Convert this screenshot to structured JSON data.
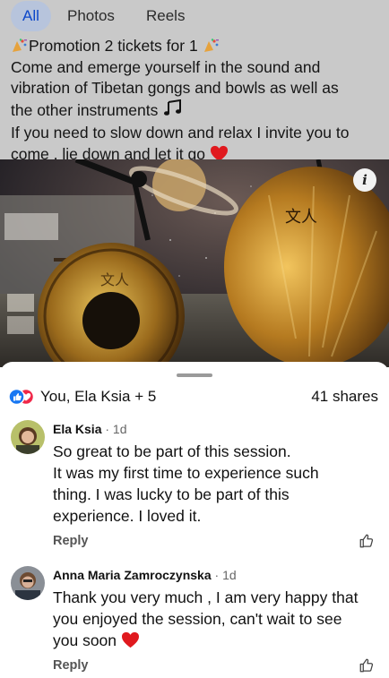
{
  "tabs": [
    {
      "label": "All"
    },
    {
      "label": "Photos"
    },
    {
      "label": "Reels"
    }
  ],
  "post": {
    "line1": "Promotion 2 tickets for 1",
    "line2": "Come and emerge yourself in the sound and",
    "line3": "vibration of Tibetan gongs and bowls as well as",
    "line4": "the other instruments",
    "line5": "If you need to slow down and relax I invite you to",
    "line6": "come , lie down and let it go"
  },
  "reactions": {
    "names": "You, Ela Ksia + 5",
    "shares": "41 shares"
  },
  "comments": [
    {
      "name": "Ela Ksia",
      "time": "· 1d",
      "lines": [
        "So great to be part of this session.",
        "It was my first time to experience such",
        "thing. I was lucky to be part of this",
        "experience. I loved it."
      ],
      "reply": "Reply"
    },
    {
      "name": "Anna Maria Zamroczynska",
      "time": "· 1d",
      "lines": [
        "Thank you very much , I am very happy that",
        "you enjoyed the session, can't wait to see",
        "you soon"
      ],
      "reply": "Reply"
    }
  ],
  "icons": {
    "info": "info-icon",
    "like_reaction": "like-reaction-icon",
    "love_reaction": "love-reaction-icon",
    "thumbs_up": "thumbs-up-icon",
    "heart": "heart-emoji-icon",
    "party": "party-popper-emoji-icon",
    "notes": "music-notes-emoji-icon"
  },
  "colors": {
    "accent": "#0d47c9",
    "like_blue": "#1877f2",
    "love_red": "#f02849",
    "heart_red": "#e0191e",
    "tab_active_bg": "#b7c4dc"
  }
}
